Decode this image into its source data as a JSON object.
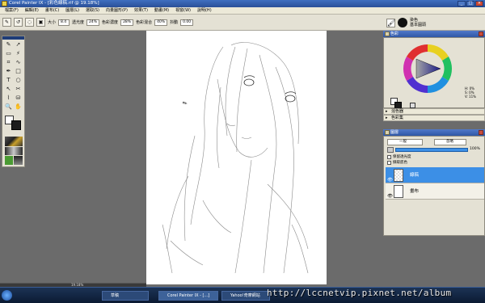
{
  "window": {
    "title": "Corel Painter IX - [彩色線稿.rif @ 19.18%]"
  },
  "menus": [
    "檔案(F)",
    "編輯(E)",
    "畫布(C)",
    "圖層(L)",
    "選取(S)",
    "向量圖形(P)",
    "效果(T)",
    "動畫(M)",
    "視窗(W)",
    "說明(H)"
  ],
  "property_bar": {
    "size_label": "大小",
    "size_value": "8.4",
    "opacity_label": "透光度",
    "opacity_value": "24%",
    "color_density_label": "色彩濃度",
    "color_density_value": "28%",
    "color_mix_label": "色彩混合",
    "color_mix_value": "40%",
    "jitter_label": "抖動",
    "jitter_value": "0.00"
  },
  "brush_selector": {
    "category": "染色",
    "variant": "基本圓頭"
  },
  "panels": {
    "color": {
      "title": "色彩",
      "h": "H: 0%",
      "s": "S: 0%",
      "v": "V: 11%"
    },
    "mixer": {
      "title": "混色器"
    },
    "color_set": {
      "title": "色彩集"
    },
    "layers": {
      "title": "圖層",
      "composite_method": "一般",
      "composite_depth": "忽略",
      "opacity": "100%",
      "preserve_transparency": "保留透光度",
      "pick_up_color": "擷取底色",
      "items": [
        {
          "name": "線稿",
          "selected": true
        },
        {
          "name": "畫布",
          "selected": false
        }
      ]
    }
  },
  "status": {
    "zoom": "19.18%"
  },
  "taskbar": {
    "items": [
      "草稿",
      "Corel Painter IX - [...]",
      "Yahoo!奇摩網站"
    ]
  },
  "watermark": "http://lccnetvip.pixnet.net/album"
}
